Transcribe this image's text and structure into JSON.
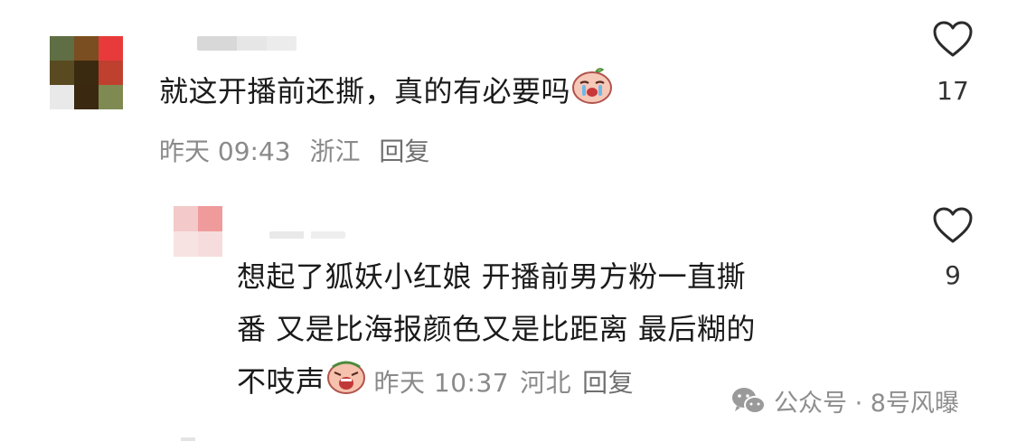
{
  "comments": [
    {
      "text": "就这开播前还撕，真的有必要吗",
      "emoji": "crying-face-emoji",
      "time": "昨天 09:43",
      "location": "浙江",
      "reply_label": "回复",
      "like_count": "17",
      "avatar_colors": [
        "#5f6e44",
        "#7a4e20",
        "#e83a3a",
        "#5a4a22",
        "#3a2a10",
        "#c04030",
        "#e9e9e9",
        "#3a2810",
        "#7e8a52"
      ]
    },
    {
      "text_lines": [
        "想起了狐妖小红娘  开播前男方粉一直撕",
        "番  又是比海报颜色又是比距离  最后糊的",
        "不吱声"
      ],
      "emoji": "screaming-face-emoji",
      "time": "昨天 10:37",
      "location": "河北",
      "reply_label": "回复",
      "like_count": "9",
      "avatar_colors": [
        "#f3c9c9",
        "#ef9b9b",
        "#f8e3e3",
        "#f6dcdc"
      ]
    }
  ],
  "watermark": {
    "icon": "wechat-icon",
    "text": "公众号 · 8号风曝"
  }
}
